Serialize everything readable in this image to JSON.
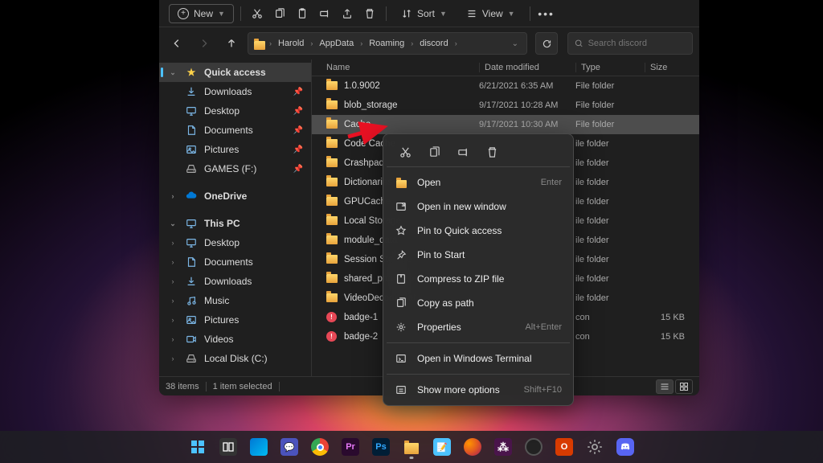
{
  "toolbar": {
    "new_label": "New",
    "sort_label": "Sort",
    "view_label": "View"
  },
  "breadcrumb": {
    "parts": [
      "Harold",
      "AppData",
      "Roaming",
      "discord"
    ]
  },
  "search": {
    "placeholder": "Search discord"
  },
  "sidebar": {
    "quick_access": "Quick access",
    "pinned": [
      {
        "label": "Downloads",
        "icon": "downloads"
      },
      {
        "label": "Desktop",
        "icon": "desktop"
      },
      {
        "label": "Documents",
        "icon": "documents"
      },
      {
        "label": "Pictures",
        "icon": "pictures"
      },
      {
        "label": "GAMES (F:)",
        "icon": "drive"
      }
    ],
    "onedrive": "OneDrive",
    "thispc": "This PC",
    "pc_items": [
      {
        "label": "Desktop",
        "icon": "desktop"
      },
      {
        "label": "Documents",
        "icon": "documents"
      },
      {
        "label": "Downloads",
        "icon": "downloads"
      },
      {
        "label": "Music",
        "icon": "music"
      },
      {
        "label": "Pictures",
        "icon": "pictures"
      },
      {
        "label": "Videos",
        "icon": "videos"
      },
      {
        "label": "Local Disk (C:)",
        "icon": "drive"
      }
    ]
  },
  "columns": {
    "name": "Name",
    "date": "Date modified",
    "type": "Type",
    "size": "Size"
  },
  "files": [
    {
      "name": "1.0.9002",
      "date": "6/21/2021 6:35 AM",
      "type": "File folder",
      "size": "",
      "icon": "folder"
    },
    {
      "name": "blob_storage",
      "date": "9/17/2021 10:28 AM",
      "type": "File folder",
      "size": "",
      "icon": "folder"
    },
    {
      "name": "Cache",
      "date": "9/17/2021 10:30 AM",
      "type": "File folder",
      "size": "",
      "icon": "folder",
      "selected": true
    },
    {
      "name": "Code Cache",
      "date": "",
      "type": "ile folder",
      "size": "",
      "icon": "folder"
    },
    {
      "name": "Crashpad",
      "date": "",
      "type": "ile folder",
      "size": "",
      "icon": "folder"
    },
    {
      "name": "Dictionaries",
      "date": "",
      "type": "ile folder",
      "size": "",
      "icon": "folder"
    },
    {
      "name": "GPUCache",
      "date": "",
      "type": "ile folder",
      "size": "",
      "icon": "folder"
    },
    {
      "name": "Local Storage",
      "date": "",
      "type": "ile folder",
      "size": "",
      "icon": "folder"
    },
    {
      "name": "module_data",
      "date": "",
      "type": "ile folder",
      "size": "",
      "icon": "folder"
    },
    {
      "name": "Session Storage",
      "date": "",
      "type": "ile folder",
      "size": "",
      "icon": "folder"
    },
    {
      "name": "shared_proto_db",
      "date": "",
      "type": "ile folder",
      "size": "",
      "icon": "folder"
    },
    {
      "name": "VideoDecodeStats",
      "date": "",
      "type": "ile folder",
      "size": "",
      "icon": "folder"
    },
    {
      "name": "badge-1",
      "date": "",
      "type": "con",
      "size": "15 KB",
      "icon": "badge"
    },
    {
      "name": "badge-2",
      "date": "",
      "type": "con",
      "size": "15 KB",
      "icon": "badge"
    }
  ],
  "status": {
    "items": "38 items",
    "selected": "1 item selected"
  },
  "context_menu": {
    "open": "Open",
    "open_shortcut": "Enter",
    "open_new": "Open in new window",
    "pin_qa": "Pin to Quick access",
    "pin_start": "Pin to Start",
    "compress": "Compress to ZIP file",
    "copy_path": "Copy as path",
    "properties": "Properties",
    "properties_shortcut": "Alt+Enter",
    "terminal": "Open in Windows Terminal",
    "more": "Show more options",
    "more_shortcut": "Shift+F10"
  }
}
